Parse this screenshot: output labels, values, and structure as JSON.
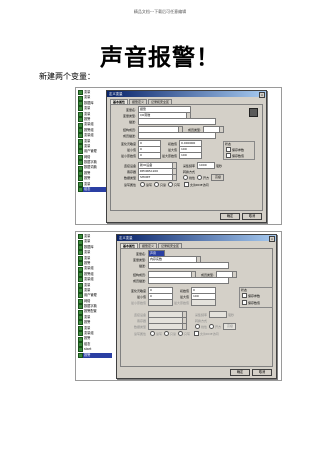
{
  "header": {
    "note": "精品文档---下载后可任意编辑"
  },
  "title": "声音报警！",
  "subtitle": "新建两个变量：",
  "screenshot1": {
    "tree_items": [
      "变量",
      "变量",
      "数据库",
      "变量",
      "变量",
      "报警",
      "变量组",
      "报警组",
      "变量组",
      "变量",
      "变量",
      "用户管理",
      "网络",
      "数据字典",
      "数据词典",
      "报警",
      "报警",
      "变量",
      "组态"
    ],
    "dialog": {
      "title": "定义变量",
      "tabs": [
        "基本属性",
        "报警定义",
        "记录和安全区"
      ],
      "var_name_label": "变量名:",
      "var_name_value": "报警",
      "var_type_label": "变量类型:",
      "var_type_value": "I/O离散",
      "desc_label": "描述:",
      "struct_label": "结构成员:",
      "member_type_label": "成员类型:",
      "member_desc_label": "成员描述:",
      "change_label": "变化灵敏度",
      "change_value": "0",
      "init_label": "初始值",
      "init_value": "0.000000",
      "min_label": "最小值",
      "min_value": "0",
      "max_label": "最大值",
      "max_value": "100",
      "minraw_label": "最小原始值",
      "minraw_value": "0",
      "maxraw_label": "最大原始值",
      "maxraw_value": "100",
      "state_label": "状态",
      "save_param": "保存参数",
      "save_value": "保存数值",
      "device_label": "连接设备",
      "device_value": "新IO设备",
      "reg_label": "寄存器",
      "reg_value": "DECREA100",
      "datatype_label": "数据类型",
      "datatype_value": "SHORT",
      "rw_label": "读写属性",
      "collect_label": "采集频率",
      "collect_value": "1000",
      "collect_unit": "毫秒",
      "convert_label": "转换方式",
      "convert_linear": "线性",
      "convert_sqrt": "开方",
      "adv": "高级",
      "rw_options": [
        "读写",
        "只读",
        "只写"
      ],
      "allow_dde": "允许DDE访问",
      "ok": "确定",
      "cancel": "取消"
    }
  },
  "screenshot2": {
    "tree_items": [
      "变量",
      "变量",
      "数据库",
      "变量",
      "变量",
      "报警",
      "变量组",
      "报警组",
      "变量组",
      "变量",
      "变量",
      "用户管理",
      "网络",
      "数据字典",
      "报警配置",
      "变量",
      "报警",
      "变量",
      "变量组",
      "报警",
      "组态",
      "start",
      "报警"
    ],
    "dialog": {
      "title": "定义变量",
      "tabs": [
        "基本属性",
        "报警定义",
        "记录和安全区"
      ],
      "var_name_label": "变量名:",
      "var_name_value": "声音",
      "var_type_label": "变量类型:",
      "var_type_value": "内存实数",
      "desc_label": "描述:",
      "struct_label": "结构成员:",
      "member_type_label": "成员类型:",
      "member_desc_label": "成员描述:",
      "change_label": "变化灵敏度",
      "change_value": "0",
      "init_label": "初始值",
      "init_value": "0",
      "min_label": "最小值",
      "min_value": "0",
      "max_label": "最大值",
      "max_value": "100",
      "minraw_label": "最小原始值",
      "maxraw_label": "最大原始值",
      "state_label": "状态",
      "save_param": "保存参数",
      "save_value": "保存数值",
      "device_label": "连接设备",
      "reg_label": "寄存器",
      "datatype_label": "数据类型",
      "rw_label": "读写属性",
      "collect_label": "采集频率",
      "collect_unit": "毫秒",
      "convert_label": "转换方式",
      "convert_linear": "线性",
      "convert_sqrt": "开方",
      "adv": "高级",
      "rw_options": [
        "读写",
        "只读",
        "只写"
      ],
      "allow_dde": "允许DDE访问",
      "ok": "确定",
      "cancel": "取消"
    }
  }
}
